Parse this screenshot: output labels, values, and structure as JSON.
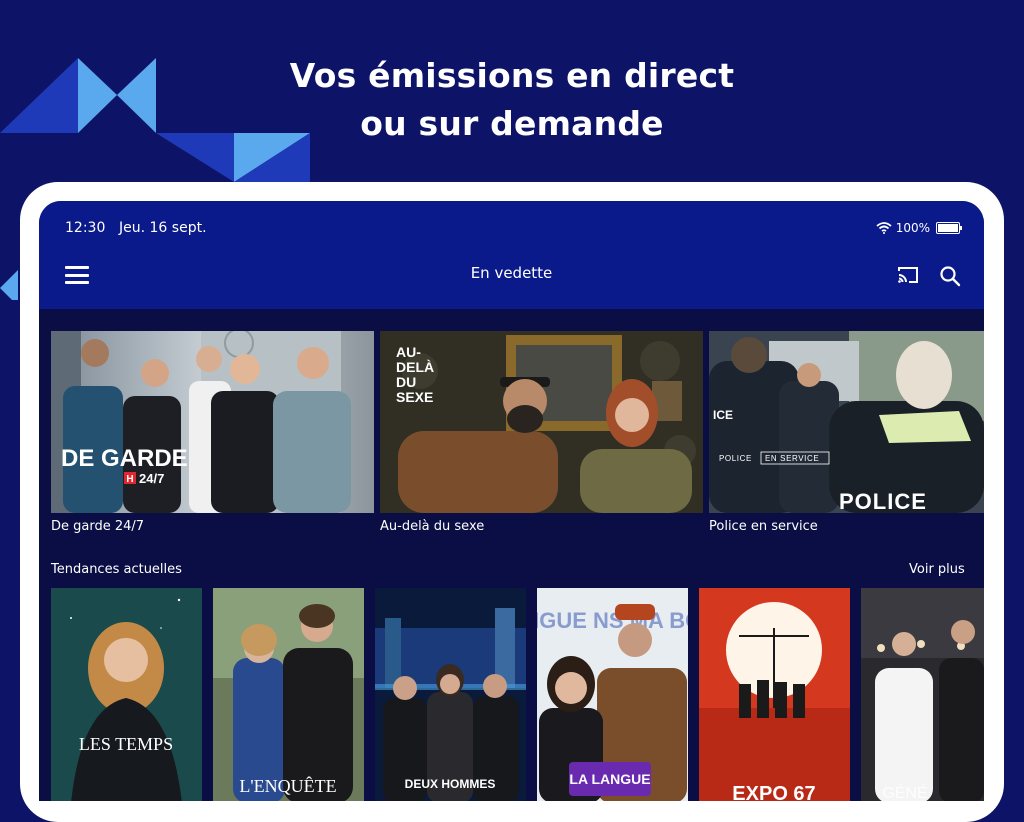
{
  "headline": {
    "line1": "Vos émissions en direct",
    "line2": "ou sur demande"
  },
  "status_bar": {
    "time": "12:30",
    "date": "Jeu. 16 sept.",
    "battery": "100%",
    "battery_level": 1.0
  },
  "app_bar": {
    "title": "En vedette"
  },
  "featured": [
    {
      "caption": "De garde 24/7",
      "art_title": "DE GARDE",
      "art_sub": "24/7",
      "art_badge": "H"
    },
    {
      "caption": "Au-delà du sexe",
      "art_title": "AU-\nDELÀ\nDU\nSEXE"
    },
    {
      "caption": "Police en service",
      "art_title_left": "POLICE",
      "art_title_right": "EN SERVICE",
      "art_back": "POLICE",
      "art_sleeve": "ICE"
    }
  ],
  "trending": {
    "title": "Tendances actuelles",
    "see_more": "Voir plus",
    "posters": [
      {
        "art_title": "LES TEMPS"
      },
      {
        "art_title": "L'ENQUÊTE"
      },
      {
        "art_title": "DEUX HOMMES"
      },
      {
        "art_title": "LA LANGUE",
        "art_top": "LA LANGUE NS MA BOUCHE"
      },
      {
        "art_title": "EXPO 67"
      },
      {
        "art_title": "GÉNÉ"
      }
    ]
  },
  "colors": {
    "background": "#0d1468",
    "app_bar": "#0b1a8a",
    "screen": "#0a0e45",
    "device": "#ffffff",
    "deco_dark": "#1e3ab8",
    "deco_light": "#5aa8ee"
  }
}
